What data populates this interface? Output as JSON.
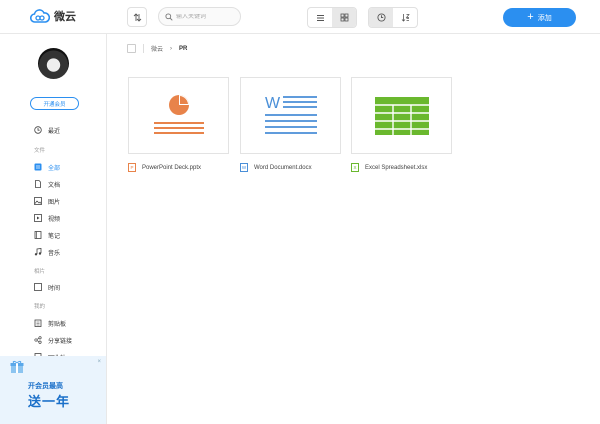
{
  "app": {
    "brand": "微云",
    "accent": "#2b8ff0"
  },
  "toolbar": {
    "search_placeholder": "输入关键词",
    "add_label": "添加"
  },
  "sidebar": {
    "vip_label": "开通会员",
    "recent": "最近",
    "section_files": "文件",
    "items": [
      {
        "label": "全部",
        "icon": "all-files-icon",
        "active": true
      },
      {
        "label": "文档",
        "icon": "document-icon"
      },
      {
        "label": "图片",
        "icon": "image-icon"
      },
      {
        "label": "视频",
        "icon": "video-icon"
      },
      {
        "label": "笔记",
        "icon": "notes-icon"
      },
      {
        "label": "音乐",
        "icon": "music-icon"
      }
    ],
    "section_photos": "相片",
    "photos_time": "时间",
    "section_mine": "我的",
    "mine_items": [
      {
        "label": "剪贴板",
        "icon": "clipboard-icon"
      },
      {
        "label": "分享链接",
        "icon": "share-link-icon"
      },
      {
        "label": "回收站",
        "icon": "recycle-bin-icon"
      }
    ],
    "promo_line1": "开会员最高",
    "promo_line2": "送一年"
  },
  "breadcrumb": {
    "root": "微云",
    "current": "PR"
  },
  "files": [
    {
      "name": "PowerPoint Deck.pptx",
      "type": "pptx",
      "color": "#e8834a"
    },
    {
      "name": "Word Document.docx",
      "type": "docx",
      "color": "#4a8fd8"
    },
    {
      "name": "Excel Spreadsheet.xlsx",
      "type": "xlsx",
      "color": "#6ab82e"
    }
  ]
}
